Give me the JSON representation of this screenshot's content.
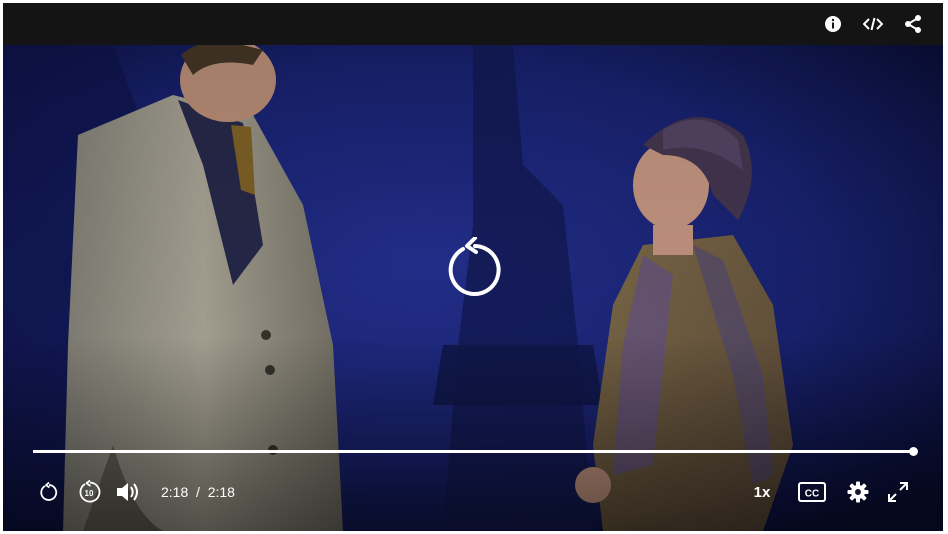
{
  "header": {
    "info_icon": "info-icon",
    "embed_icon": "embed-code-icon",
    "share_icon": "share-icon"
  },
  "overlay": {
    "replay_icon": "replay-icon"
  },
  "progress": {
    "played_fraction": 1.0
  },
  "controls": {
    "current_time": "2:18",
    "separator": "/",
    "duration": "2:18",
    "speed_label": "1x",
    "icons": {
      "replay": "replay-icon",
      "rewind": "rewind-10-icon",
      "volume": "volume-icon",
      "captions": "closed-captions-icon",
      "settings": "gear-icon",
      "fullscreen": "fullscreen-icon"
    }
  },
  "colors": {
    "stage_blue": "#1a2478",
    "topbar": "#141414",
    "controls_text": "#ffffff"
  }
}
